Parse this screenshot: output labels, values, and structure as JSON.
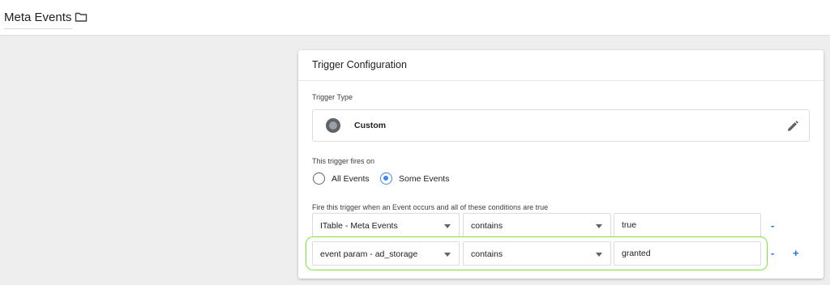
{
  "header": {
    "title": "Meta Events",
    "folder_icon": "folder-icon"
  },
  "trigger": {
    "section_title": "Trigger Configuration",
    "type_label": "Trigger Type",
    "type_name": "Custom",
    "type_icon": "custom-event-icon",
    "edit_icon": "pencil-icon",
    "fires_on_label": "This trigger fires on",
    "options": [
      {
        "label": "All Events",
        "selected": false
      },
      {
        "label": "Some Events",
        "selected": true
      }
    ],
    "conditions_label": "Fire this trigger when an Event occurs and all of these conditions are true",
    "conditions": [
      {
        "variable": "ITable - Meta Events",
        "operator": "contains",
        "value": "true",
        "remove": "-"
      },
      {
        "variable": "event param - ad_storage",
        "operator": "contains",
        "value": "granted",
        "remove": "-",
        "add": "+"
      }
    ],
    "accent_color": "#4285f4",
    "highlight_color": "#7fe43a"
  }
}
